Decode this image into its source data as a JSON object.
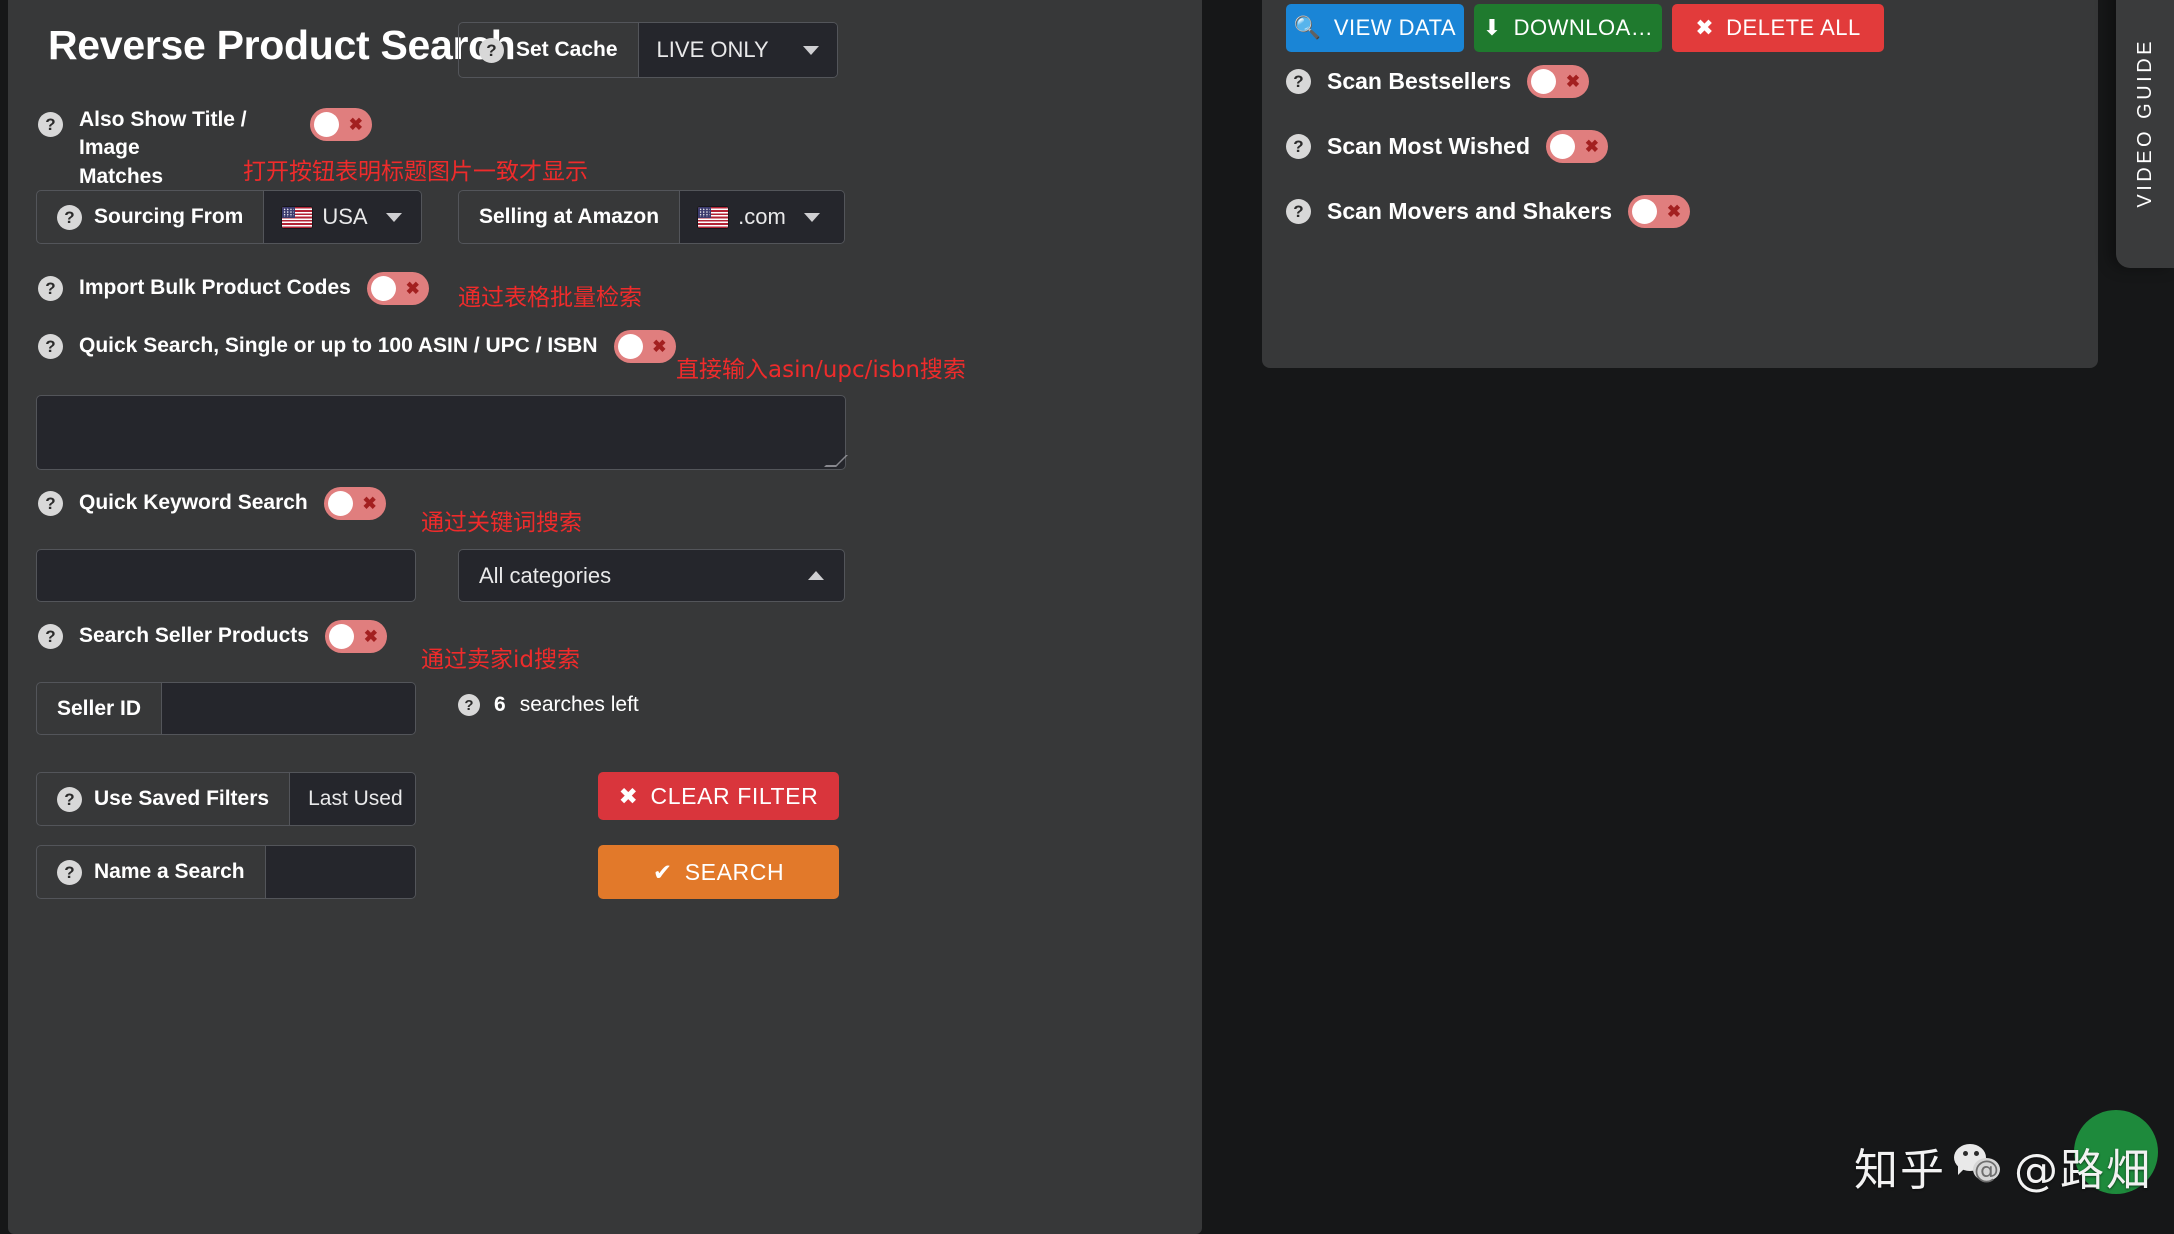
{
  "page": {
    "bg_color": "#161718",
    "panel_color": "#373839",
    "field_color": "#25262c",
    "accent_red": "#d9353c",
    "accent_orange": "#e2792a",
    "accent_blue": "#1a85d6",
    "accent_green": "#1f7a2e",
    "annotation_color": "#ef2b2b",
    "toggle_off_color": "#e07e7e"
  },
  "left_panel": {
    "title": "Reverse Product Search",
    "set_cache": {
      "help_icon": "question-mark-icon",
      "label": "Set Cache",
      "value": "LIVE ONLY",
      "caret_icon": "chevron-down-icon"
    },
    "also_show": {
      "help_icon": "question-mark-icon",
      "label_line1": "Also Show Title / Image",
      "label_line2": "Matches",
      "toggle_state": "off",
      "toggle_x_icon": "close-x-icon",
      "annotation": "打开按钮表明标题图片一致才显示"
    },
    "sourcing_from": {
      "help_icon": "question-mark-icon",
      "label": "Sourcing From",
      "flag_icon": "usa-flag-icon",
      "value": "USA",
      "caret_icon": "chevron-down-icon"
    },
    "selling_at": {
      "label": "Selling at Amazon",
      "flag_icon": "usa-flag-icon",
      "value": ".com",
      "caret_icon": "chevron-down-icon"
    },
    "import_bulk": {
      "help_icon": "question-mark-icon",
      "label": "Import Bulk Product Codes",
      "toggle_state": "off",
      "annotation": "通过表格批量检索"
    },
    "quick_search": {
      "help_icon": "question-mark-icon",
      "label": "Quick Search, Single or up to 100 ASIN / UPC / ISBN",
      "toggle_state": "off",
      "annotation": "直接输入asin/upc/isbn搜索",
      "textarea_value": "",
      "textarea_placeholder": ""
    },
    "quick_keyword": {
      "help_icon": "question-mark-icon",
      "label": "Quick Keyword Search",
      "toggle_state": "off",
      "annotation": "通过关键词搜索",
      "keyword_value": "",
      "keyword_placeholder": "",
      "category_value": "All categories",
      "category_caret_icon": "chevron-up-icon"
    },
    "search_seller": {
      "help_icon": "question-mark-icon",
      "label": "Search Seller Products",
      "toggle_state": "off",
      "annotation": "通过卖家id搜索",
      "seller_id_label": "Seller ID",
      "seller_id_value": "",
      "seller_id_placeholder": ""
    },
    "searches_left": {
      "help_icon": "question-mark-icon",
      "count": "6",
      "text": "searches left"
    },
    "use_saved_filters": {
      "help_icon": "question-mark-icon",
      "label": "Use Saved Filters",
      "value": "Last Used",
      "caret_icon": "chevron-up-icon"
    },
    "name_a_search": {
      "help_icon": "question-mark-icon",
      "label": "Name a Search",
      "value": "",
      "placeholder": ""
    },
    "clear_filter_button": {
      "icon": "close-x-icon",
      "label": "CLEAR FILTER"
    },
    "search_button": {
      "icon": "check-icon",
      "label": "SEARCH"
    }
  },
  "right_panel": {
    "buttons": [
      {
        "id": "view-data",
        "icon": "search-icon",
        "label": "VIEW DATA",
        "color": "#1a85d6"
      },
      {
        "id": "download",
        "icon": "download-arrow-icon",
        "label": "DOWNLOA…",
        "color": "#1f7a2e"
      },
      {
        "id": "delete-all",
        "icon": "close-x-icon",
        "label": "DELETE ALL",
        "color": "#e23b3b"
      }
    ],
    "toggles": [
      {
        "id": "scan-bestsellers",
        "help_icon": "question-mark-icon",
        "label": "Scan Bestsellers",
        "state": "off"
      },
      {
        "id": "scan-most-wished",
        "help_icon": "question-mark-icon",
        "label": "Scan Most Wished",
        "state": "off"
      },
      {
        "id": "scan-movers-and-shakers",
        "help_icon": "question-mark-icon",
        "label": "Scan Movers and Shakers",
        "state": "off"
      }
    ]
  },
  "video_guide_tab": {
    "label": "VIDEO GUIDE"
  },
  "watermark": {
    "platform": "知乎",
    "icon": "wechat-icon",
    "handle": "@路畑"
  }
}
